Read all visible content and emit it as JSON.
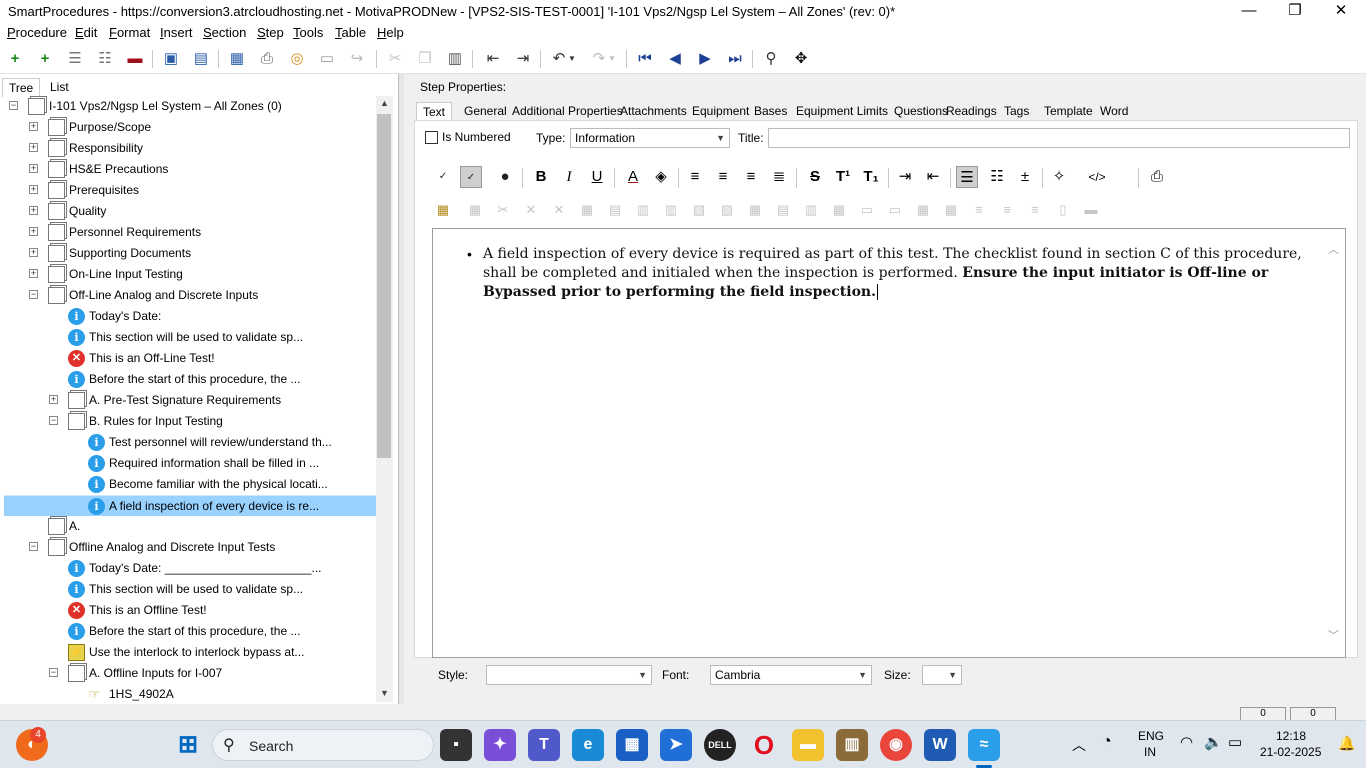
{
  "window": {
    "title": "SmartProcedures - https://conversion3.atrcloudhosting.net - MotivaPRODNew - [VPS2-SIS-TEST-0001] 'I-101 Vps2/Ngsp Lel System – All Zones' (rev: 0)*"
  },
  "menu": [
    {
      "label": "Procedure",
      "u": "P",
      "rest": "rocedure"
    },
    {
      "label": "Edit",
      "u": "E",
      "rest": "dit"
    },
    {
      "label": "Format",
      "u": "F",
      "rest": "ormat"
    },
    {
      "label": "Insert",
      "u": "I",
      "rest": "nsert"
    },
    {
      "label": "Section",
      "u": "S",
      "rest": "ection"
    },
    {
      "label": "Step",
      "u": "S",
      "rest": "tep"
    },
    {
      "label": "Tools",
      "u": "T",
      "rest": "ools"
    },
    {
      "label": "Table",
      "u": "T",
      "rest": "able"
    },
    {
      "label": "Help",
      "u": "H",
      "rest": "elp"
    }
  ],
  "left_tabs": {
    "tree": "Tree",
    "list": "List"
  },
  "tree": [
    {
      "label": "I-101 Vps2/Ngsp Lel System – All Zones (0)",
      "icon": "document-icon",
      "level": 0,
      "exp": "minus"
    },
    {
      "label": "Purpose/Scope",
      "icon": "document-icon",
      "level": 1,
      "exp": "plus"
    },
    {
      "label": "Responsibility",
      "icon": "document-icon",
      "level": 1,
      "exp": "plus"
    },
    {
      "label": "HS&E Precautions",
      "icon": "document-icon",
      "level": 1,
      "exp": "plus"
    },
    {
      "label": "Prerequisites",
      "icon": "document-icon",
      "level": 1,
      "exp": "plus"
    },
    {
      "label": "Quality",
      "icon": "document-icon",
      "level": 1,
      "exp": "plus"
    },
    {
      "label": "Personnel Requirements",
      "icon": "document-icon",
      "level": 1,
      "exp": "plus"
    },
    {
      "label": "Supporting Documents",
      "icon": "document-icon",
      "level": 1,
      "exp": "plus"
    },
    {
      "label": "On-Line Input Testing",
      "icon": "document-icon",
      "level": 1,
      "exp": "plus"
    },
    {
      "label": "Off-Line Analog and Discrete Inputs",
      "icon": "document-icon",
      "level": 1,
      "exp": "minus"
    },
    {
      "label": "Today's Date:",
      "icon": "info-icon",
      "level": 2,
      "exp": ""
    },
    {
      "label": "This section will be used to validate sp...",
      "icon": "info-icon",
      "level": 2,
      "exp": ""
    },
    {
      "label": "This is an Off-Line Test!",
      "icon": "error-icon",
      "level": 2,
      "exp": ""
    },
    {
      "label": "Before the start of this procedure, the ...",
      "icon": "info-icon",
      "level": 2,
      "exp": ""
    },
    {
      "label": "A. Pre-Test Signature Requirements",
      "icon": "document-icon",
      "level": 2,
      "exp": "plus"
    },
    {
      "label": "B. Rules for Input Testing",
      "icon": "document-icon",
      "level": 2,
      "exp": "minus"
    },
    {
      "label": "Test personnel will review/understand th...",
      "icon": "info-icon",
      "level": 3,
      "exp": ""
    },
    {
      "label": "Required information shall be filled in ...",
      "icon": "info-icon",
      "level": 3,
      "exp": ""
    },
    {
      "label": "Become familiar with the physical locati...",
      "icon": "info-icon",
      "level": 3,
      "exp": ""
    },
    {
      "label": "A field inspection of every device is re...",
      "icon": "info-icon",
      "level": 3,
      "exp": "",
      "selected": true
    },
    {
      "label": "A.",
      "icon": "document-icon",
      "level": 1,
      "exp": ""
    },
    {
      "label": "Offline Analog and Discrete Input Tests",
      "icon": "document-icon",
      "level": 1,
      "exp": "minus"
    },
    {
      "label": "Today's Date: ______________________...",
      "icon": "info-icon",
      "level": 2,
      "exp": ""
    },
    {
      "label": "This section will be used to validate sp...",
      "icon": "info-icon",
      "level": 2,
      "exp": ""
    },
    {
      "label": "This is an Offline Test!",
      "icon": "error-icon",
      "level": 2,
      "exp": ""
    },
    {
      "label": "Before the start of this procedure, the ...",
      "icon": "info-icon",
      "level": 2,
      "exp": ""
    },
    {
      "label": "Use the interlock to interlock bypass at...",
      "icon": "warning-icon",
      "level": 2,
      "exp": ""
    },
    {
      "label": "A. Offline Inputs for I-007",
      "icon": "document-icon",
      "level": 2,
      "exp": "minus"
    },
    {
      "label": "1HS_4902A",
      "icon": "hand-icon",
      "level": 3,
      "exp": ""
    }
  ],
  "step_properties": {
    "heading": "Step Properties:",
    "tabs": [
      "Text",
      "General",
      "Additional Properties",
      "Attachments",
      "Equipment",
      "Bases",
      "Equipment Limits",
      "Questions",
      "Readings",
      "Tags",
      "Template",
      "Word"
    ],
    "is_numbered_label": "Is Numbered",
    "type_label": "Type:",
    "type_value": "Information",
    "title_label": "Title:",
    "title_value": ""
  },
  "editor": {
    "text_normal": "A field inspection of every device is required as part of this test. The checklist found in section C of this procedure, shall be completed and initialed when the inspection is performed. ",
    "text_bold": "Ensure the input initiator is Off-line or Bypassed prior to performing the field inspection."
  },
  "bottom": {
    "style_label": "Style:",
    "style_value": "",
    "font_label": "Font:",
    "font_value": "Cambria",
    "size_label": "Size:",
    "size_value": ""
  },
  "status": {
    "a": "0",
    "b": "0"
  },
  "taskbar": {
    "search_placeholder": "Search",
    "lang_top": "ENG",
    "lang_bottom": "IN",
    "time": "12:18",
    "date": "21-02-2025",
    "badge": "4"
  },
  "colors": {
    "selection": "#99d1ff",
    "info": "#2a9ee8",
    "error": "#e0312b",
    "accent": "#0067c0"
  }
}
